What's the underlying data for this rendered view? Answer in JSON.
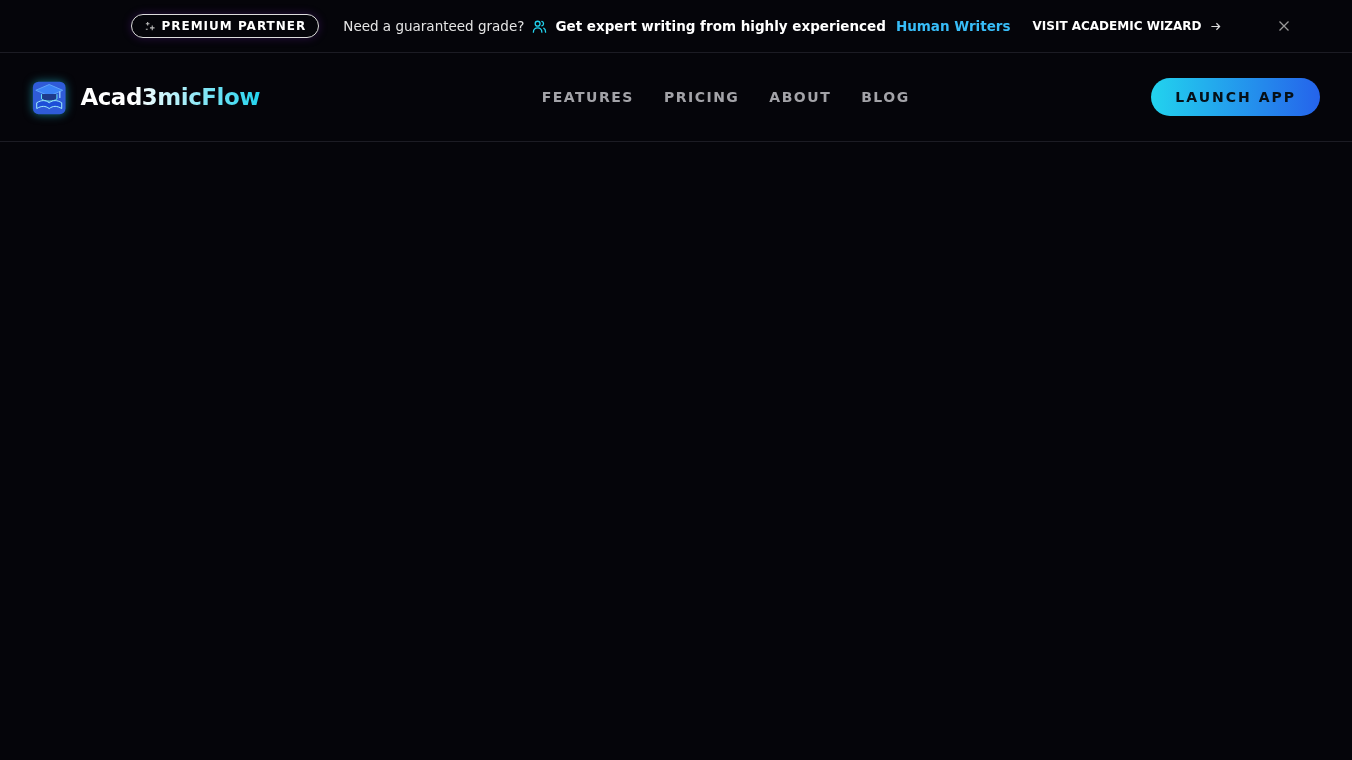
{
  "banner": {
    "badge": "PREMIUM PARTNER",
    "question": "Need a guaranteed grade?",
    "pitch": "Get expert writing from highly experienced",
    "highlight": "Human Writers",
    "cta": "VISIT ACADEMIC WIZARD"
  },
  "header": {
    "brand": "Acad3micFlow",
    "nav": [
      "FEATURES",
      "PRICING",
      "ABOUT",
      "BLOG"
    ],
    "action": "LAUNCH APP"
  }
}
